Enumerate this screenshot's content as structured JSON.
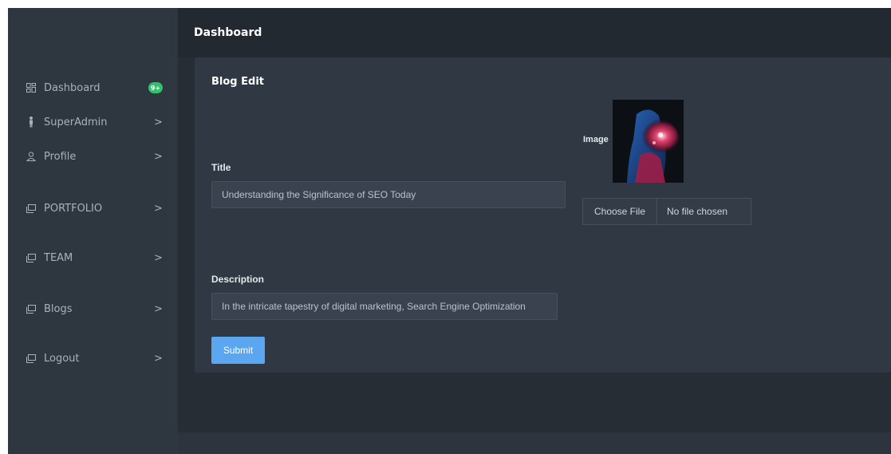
{
  "sidebar": {
    "items": [
      {
        "label": "Dashboard",
        "icon": "dashboard-icon",
        "badge": "9+"
      },
      {
        "label": "SuperAdmin",
        "icon": "person-icon",
        "arrow": ">"
      },
      {
        "label": "Profile",
        "icon": "user-icon",
        "arrow": ">"
      },
      {
        "label": "PORTFOLIO",
        "icon": "window-icon",
        "arrow": ">"
      },
      {
        "label": "TEAM",
        "icon": "window-icon",
        "arrow": ">"
      },
      {
        "label": "Blogs",
        "icon": "window-icon",
        "arrow": ">"
      },
      {
        "label": "Logout",
        "icon": "window-icon",
        "arrow": ">"
      }
    ]
  },
  "header": {
    "title": "Dashboard"
  },
  "form": {
    "card_title": "Blog Edit",
    "title_label": "Title",
    "title_value": "Understanding the Significance of SEO Today",
    "description_label": "Description",
    "description_value": "In the intricate tapestry of digital marketing, Search Engine Optimization",
    "image_label": "Image",
    "choose_file_label": "Choose File",
    "file_status": "No file chosen",
    "submit_label": "Submit"
  },
  "colors": {
    "accent": "#5aa6f0",
    "badge": "#2dc36a",
    "sidebar_bg": "#2e3640",
    "card_bg": "#303843"
  }
}
